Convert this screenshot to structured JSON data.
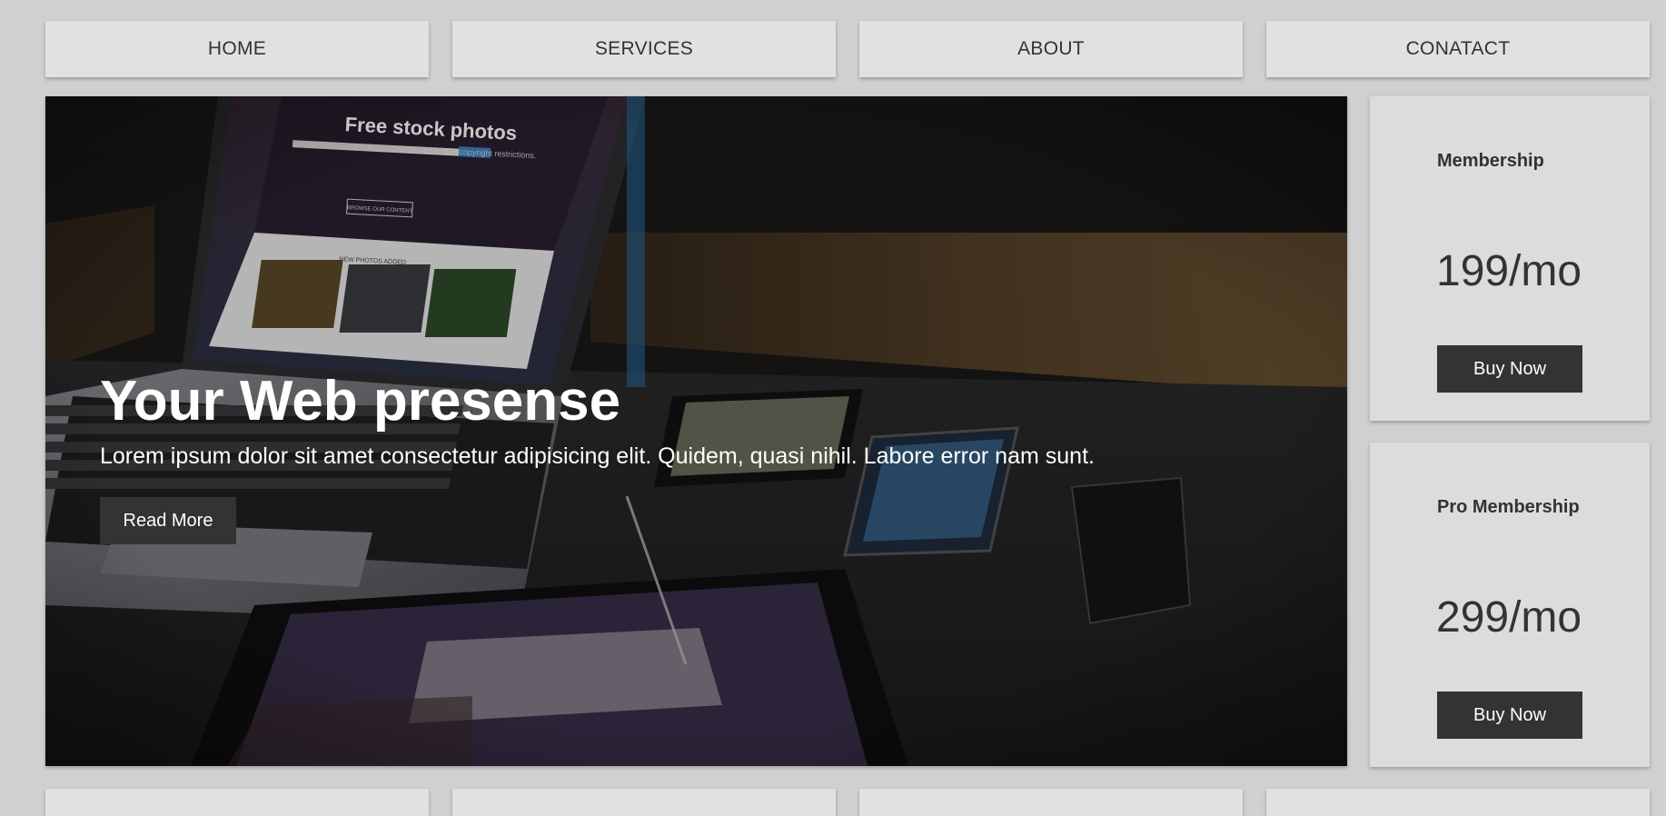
{
  "nav": {
    "items": [
      {
        "label": "HOME"
      },
      {
        "label": "SERVICES"
      },
      {
        "label": "ABOUT"
      },
      {
        "label": "CONATACT"
      }
    ]
  },
  "hero": {
    "title": "Your Web presense",
    "text": "Lorem ipsum dolor sit amet consectetur adipisicing elit. Quidem, quasi nihil. Labore error nam sunt.",
    "button_label": "Read More",
    "screen_heading": "Free stock photos",
    "screen_subheading": "All photos are released under CC0, no copyright restrictions.",
    "screen_button": "BROWSE OUR CONTENT",
    "screen_section": "NEW PHOTOS ADDED"
  },
  "pricing": [
    {
      "title": "Membership",
      "price": "199/mo",
      "button_label": "Buy Now"
    },
    {
      "title": "Pro Membership",
      "price": "299/mo",
      "button_label": "Buy Now"
    }
  ]
}
